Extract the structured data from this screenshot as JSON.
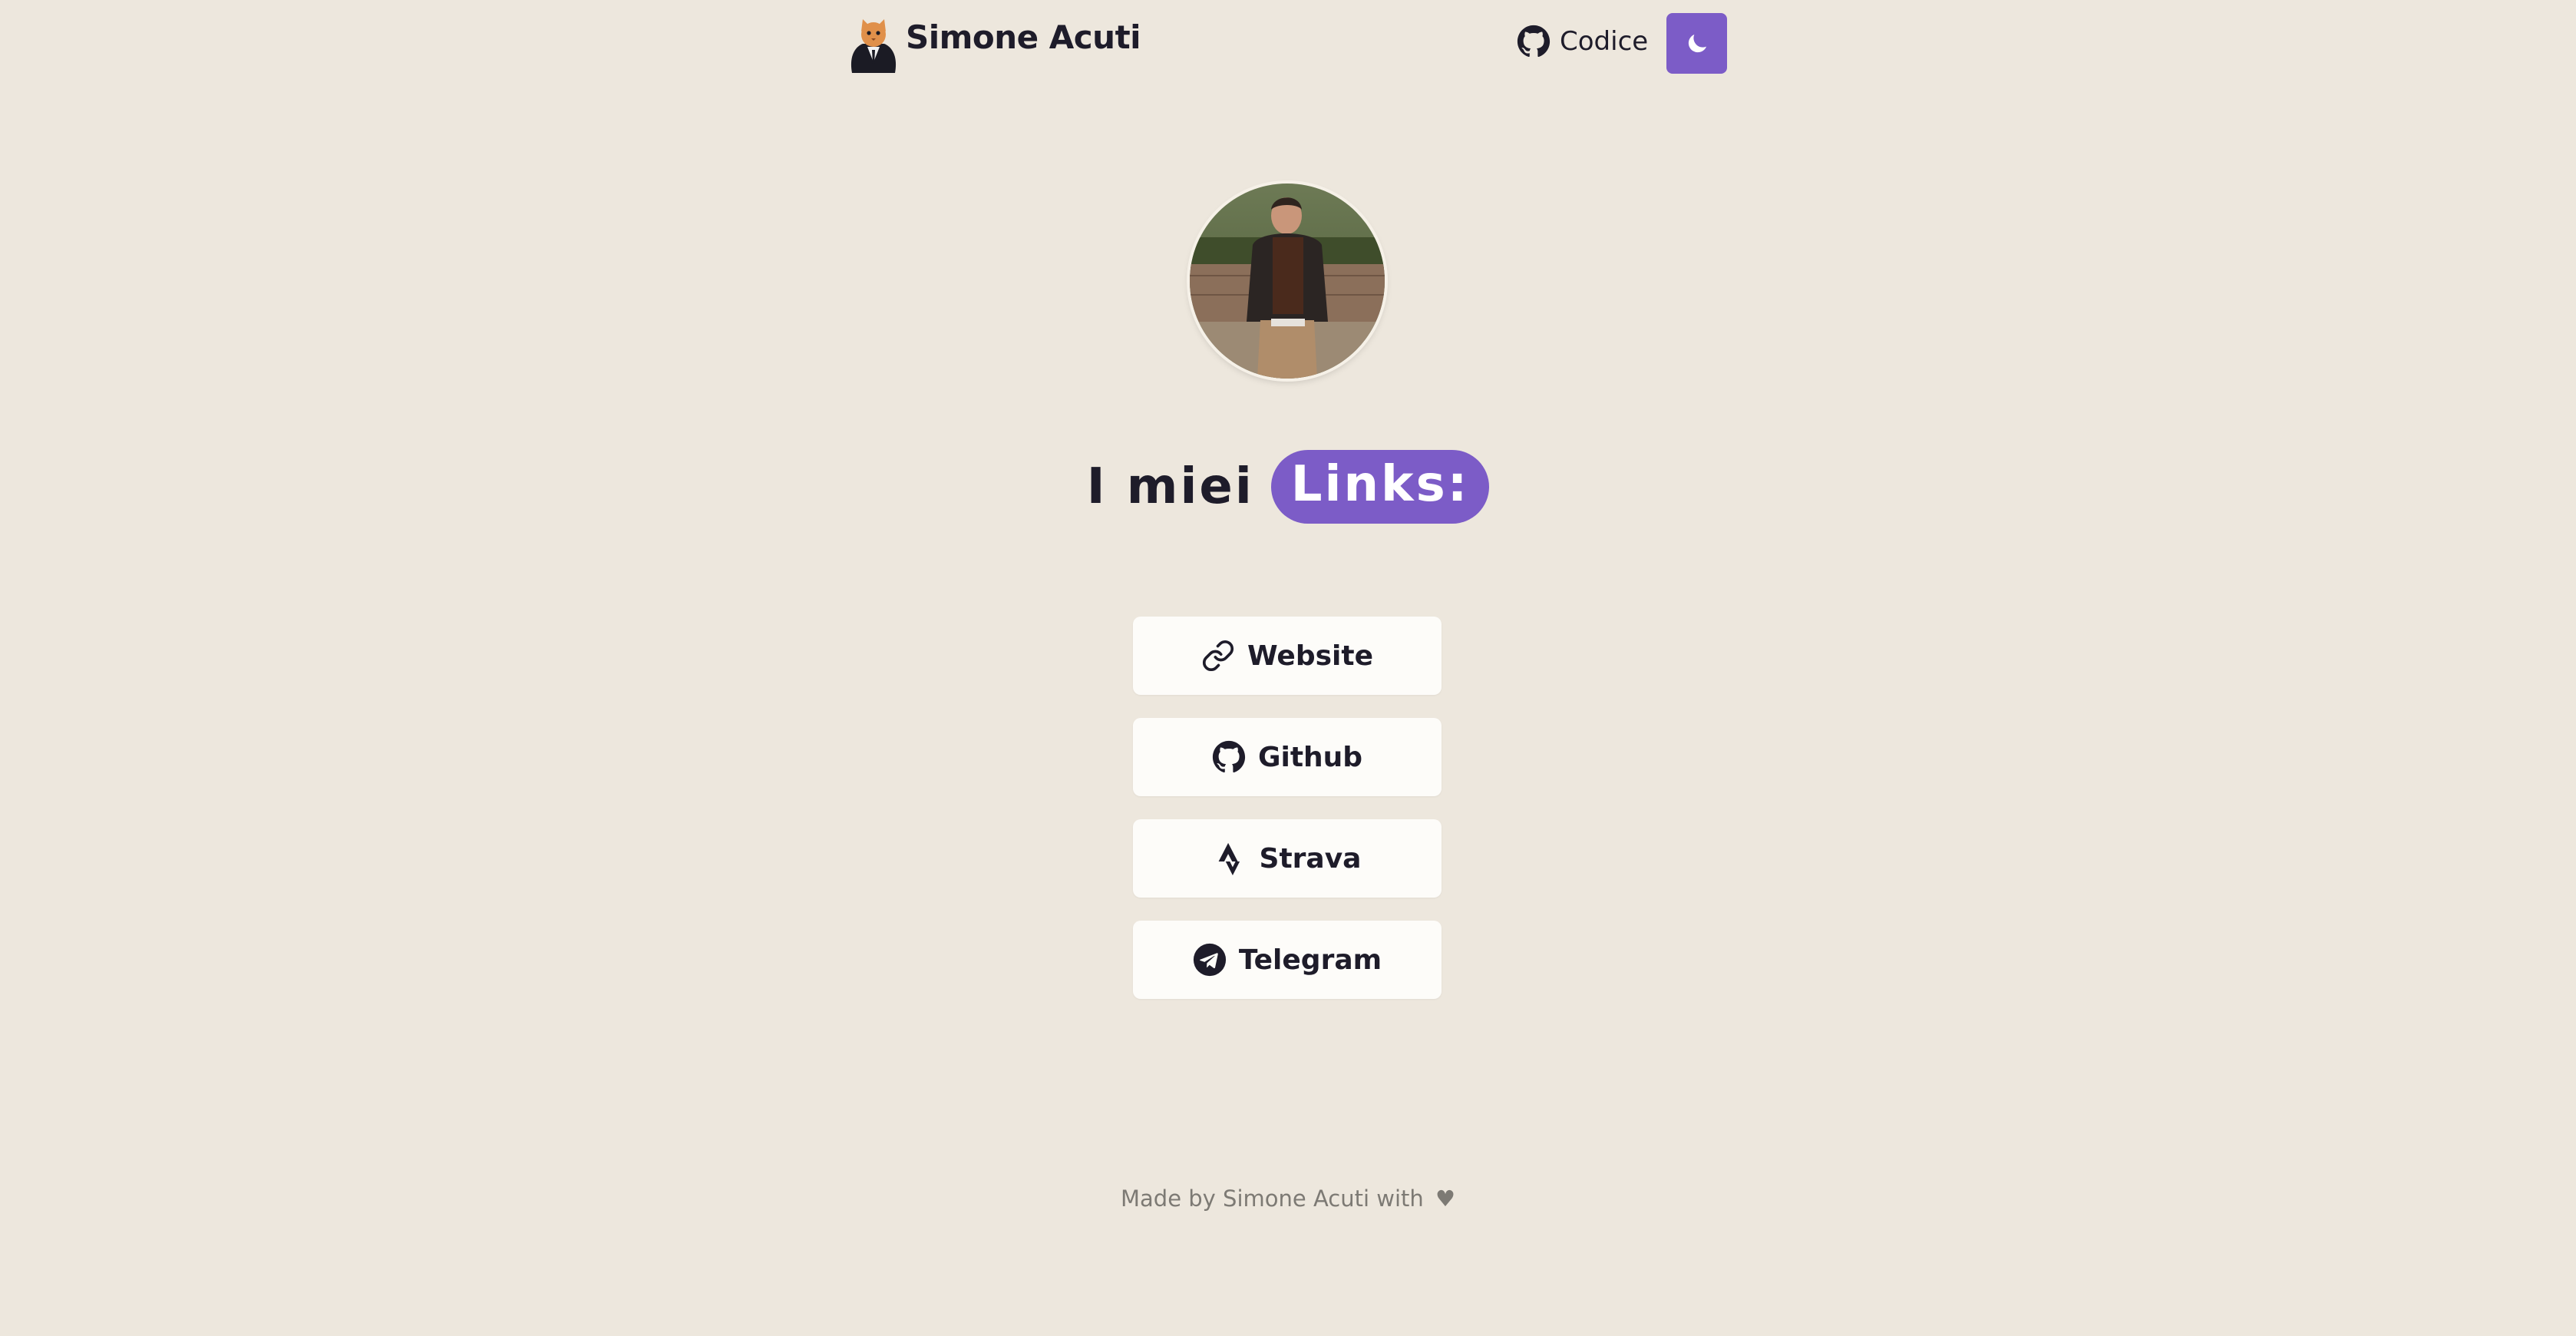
{
  "header": {
    "brand_name": "Simone Acuti",
    "code_link_label": "Codice",
    "theme_toggle_icon": "moon-icon"
  },
  "profile": {
    "avatar_icon": "profile-photo"
  },
  "title": {
    "prefix": "I miei",
    "highlight": "Links:"
  },
  "links": [
    {
      "label": "Website",
      "icon": "link-icon"
    },
    {
      "label": "Github",
      "icon": "github-icon"
    },
    {
      "label": "Strava",
      "icon": "strava-icon"
    },
    {
      "label": "Telegram",
      "icon": "telegram-icon"
    }
  ],
  "footer": {
    "text": "Made by Simone Acuti with",
    "heart": "♥"
  },
  "colors": {
    "background": "#ede7dd",
    "accent": "#7c5cc7",
    "card": "#fdfcf9",
    "text": "#1e1c2a",
    "muted": "#7d7a74"
  }
}
